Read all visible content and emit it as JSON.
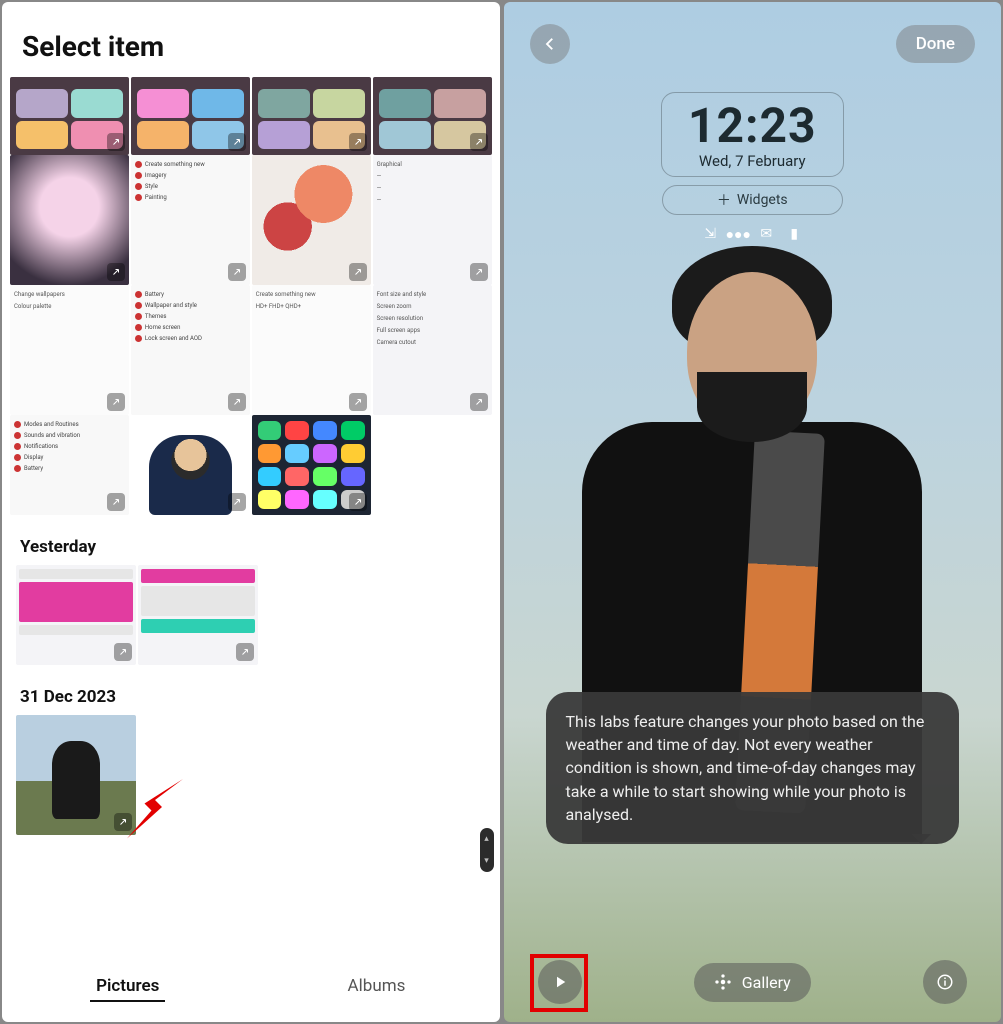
{
  "left": {
    "title": "Select item",
    "sections": {
      "yesterday": "Yesterday",
      "dec": "31 Dec 2023"
    },
    "tabs": {
      "pictures": "Pictures",
      "albums": "Albums"
    },
    "thumb_rows": {
      "a_tiles": [
        [
          "#b5a6c9",
          "#9adbd2",
          "#f5c06a",
          "#ef8fb1"
        ],
        [
          "#f58fd4",
          "#6fb8e8",
          "#f5b36a",
          "#8fc6e8"
        ],
        [
          "#7fa6a0",
          "#c7d6a0",
          "#b6a0d6",
          "#e8c08f"
        ],
        [
          "#6fa0a0",
          "#c7a0a0",
          "#a0c7d6",
          "#d6c7a0"
        ]
      ],
      "c_app_colors": [
        "#3c7",
        "#f44",
        "#48f",
        "#0c6",
        "#f93",
        "#6cf",
        "#c6f",
        "#fc3",
        "#3cf",
        "#f66",
        "#6f6",
        "#66f",
        "#ff6",
        "#f6f",
        "#6ff",
        "#ccc"
      ]
    }
  },
  "right": {
    "done": "Done",
    "time": "12:23",
    "date": "Wed, 7 February",
    "widgets_label": "Widgets",
    "tooltip": "This labs feature changes your photo based on the weather and time of day. Not every weather condition is shown, and time-of-day changes may take a while to start showing while your photo is analysed.",
    "gallery_label": "Gallery"
  }
}
